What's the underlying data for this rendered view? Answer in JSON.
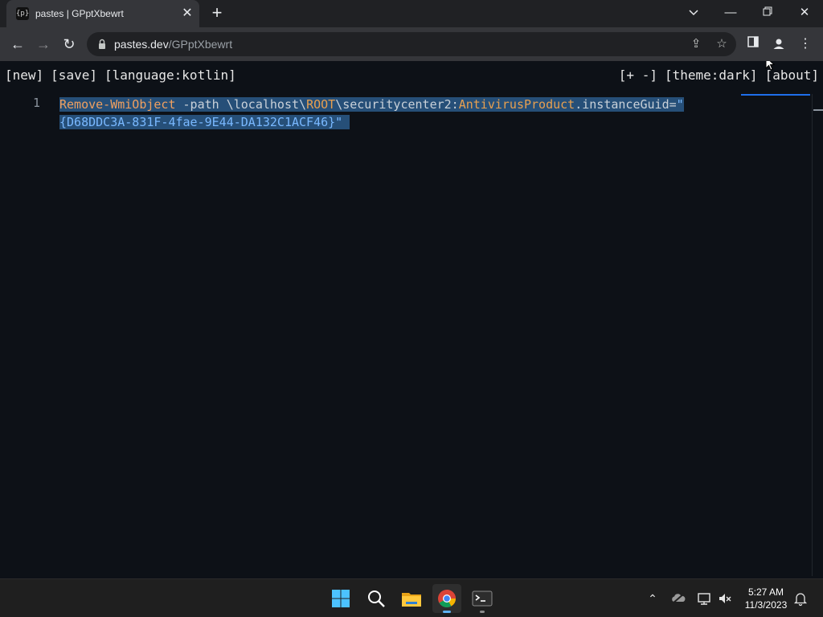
{
  "browser": {
    "tab": {
      "favicon_text": "{p}",
      "title": "pastes | GPptXbewrt"
    },
    "address": {
      "host": "pastes.dev",
      "path": "/GPptXbewrt"
    },
    "icons": {
      "back": "arrow-left-icon",
      "forward": "arrow-right-icon",
      "reload": "reload-icon",
      "lock": "lock-icon",
      "share": "share-icon",
      "bookmark": "star-icon",
      "side_panel": "side-panel-icon",
      "profile": "profile-icon",
      "menu": "kebab-menu-icon"
    }
  },
  "page": {
    "menu_left": [
      "[new]",
      "[save]",
      "[language:kotlin]"
    ],
    "menu_right": [
      "[+ -]",
      "[theme:dark]",
      "[about]"
    ],
    "editor": {
      "line_number": "1",
      "code": {
        "cmd": "Remove-WmiObject",
        "arg1": " -path \\localhost\\",
        "root": "ROOT",
        "arg2": "\\securitycenter2:",
        "product": "AntivirusProduct",
        "arg3": ".instanceGuid=",
        "quote_open": "\"",
        "guid": "{D68DDC3A-831F-4fae-9E44-DA132C1ACF46}",
        "quote_close": "\""
      }
    }
  },
  "taskbar": {
    "apps": [
      "windows-start-icon",
      "search-icon",
      "file-explorer-icon",
      "chrome-icon",
      "terminal-icon"
    ],
    "tray": [
      "chevron-up-icon",
      "onedrive-icon",
      "network-icon",
      "volume-muted-icon"
    ],
    "clock": {
      "time": "5:27 AM",
      "date": "11/3/2023"
    }
  },
  "colors": {
    "page_bg": "#0d1117",
    "selection": "#264f78",
    "keyword": "#f0a060",
    "string": "#79b8ff"
  }
}
